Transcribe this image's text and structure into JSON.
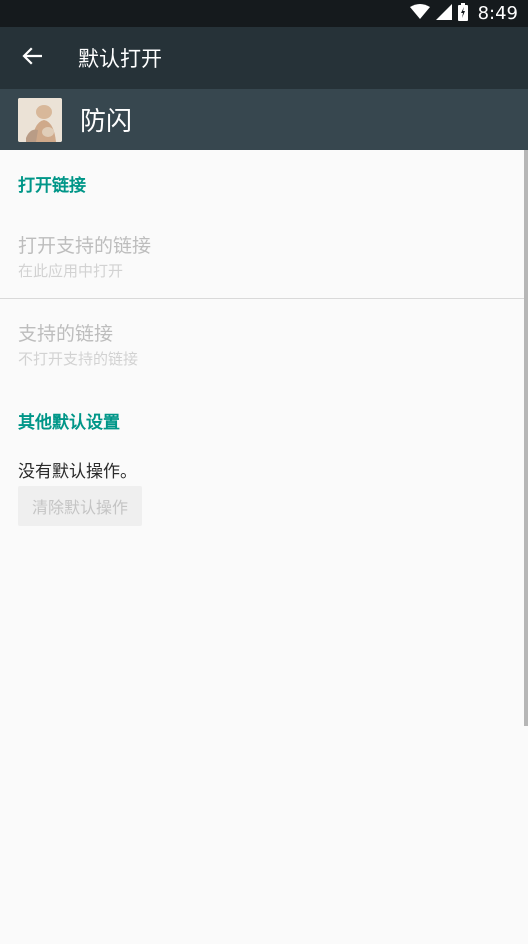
{
  "status_bar": {
    "time": "8:49"
  },
  "toolbar": {
    "title": "默认打开",
    "back_icon": "arrow-back-icon"
  },
  "app_header": {
    "name": "防闪",
    "icon": "app-icon"
  },
  "sections": {
    "open_links": {
      "header": "打开链接",
      "open_supported": {
        "title": "打开支持的链接",
        "summary": "在此应用中打开"
      },
      "supported_links": {
        "title": "支持的链接",
        "summary": "不打开支持的链接"
      }
    },
    "other_defaults": {
      "header": "其他默认设置",
      "no_default_text": "没有默认操作。",
      "clear_button": "清除默认操作"
    }
  },
  "colors": {
    "accent": "#009688",
    "toolbar": "#263238",
    "app_header": "#37474f",
    "status_bar": "#151a1d"
  }
}
